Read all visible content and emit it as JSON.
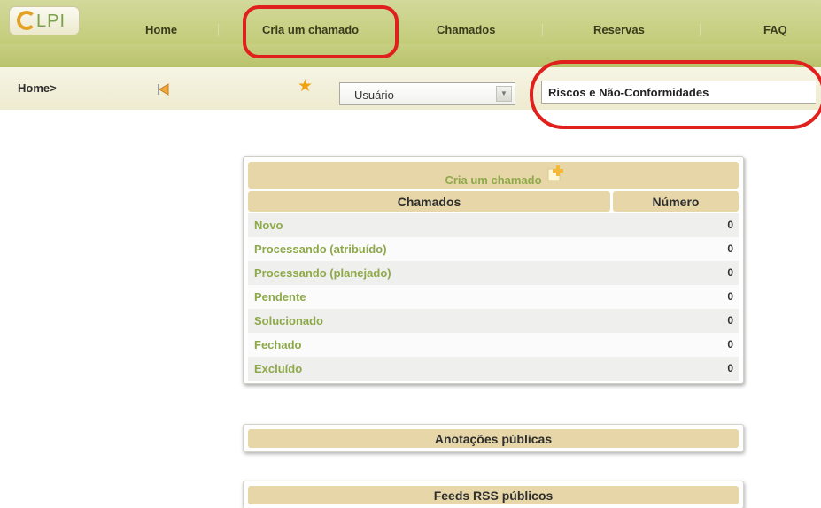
{
  "header": {
    "logo_text": "LPI",
    "menu": [
      {
        "label": "Home"
      },
      {
        "label": "Cria um chamado"
      },
      {
        "label": "Chamados"
      },
      {
        "label": "Reservas"
      },
      {
        "label": "FAQ"
      }
    ]
  },
  "breadcrumb": {
    "text": "Home>"
  },
  "toolbar": {
    "profile_select_value": "Usuário",
    "entity_value": "Riscos e Não-Conformidades"
  },
  "tickets_panel": {
    "title": "Cria um chamado",
    "col_status": "Chamados",
    "col_count": "Número",
    "rows": [
      {
        "label": "Novo",
        "count": "0"
      },
      {
        "label": "Processando (atribuído)",
        "count": "0"
      },
      {
        "label": "Processando (planejado)",
        "count": "0"
      },
      {
        "label": "Pendente",
        "count": "0"
      },
      {
        "label": "Solucionado",
        "count": "0"
      },
      {
        "label": "Fechado",
        "count": "0"
      },
      {
        "label": "Excluído",
        "count": "0"
      }
    ]
  },
  "sections": {
    "public_notes": "Anotações públicas",
    "public_rss": "Feeds RSS públicos"
  },
  "colors": {
    "menu_bar": "#c3cc79",
    "accent_green": "#8ea94a",
    "table_header": "#e7d6a7",
    "highlight_red": "#e0201c",
    "star": "#f2a20f"
  },
  "icons": {
    "back": "back-arrow-icon",
    "bookmark": "star-icon",
    "add_ticket": "plus-icon",
    "dropdown": "chevron-down-icon"
  }
}
